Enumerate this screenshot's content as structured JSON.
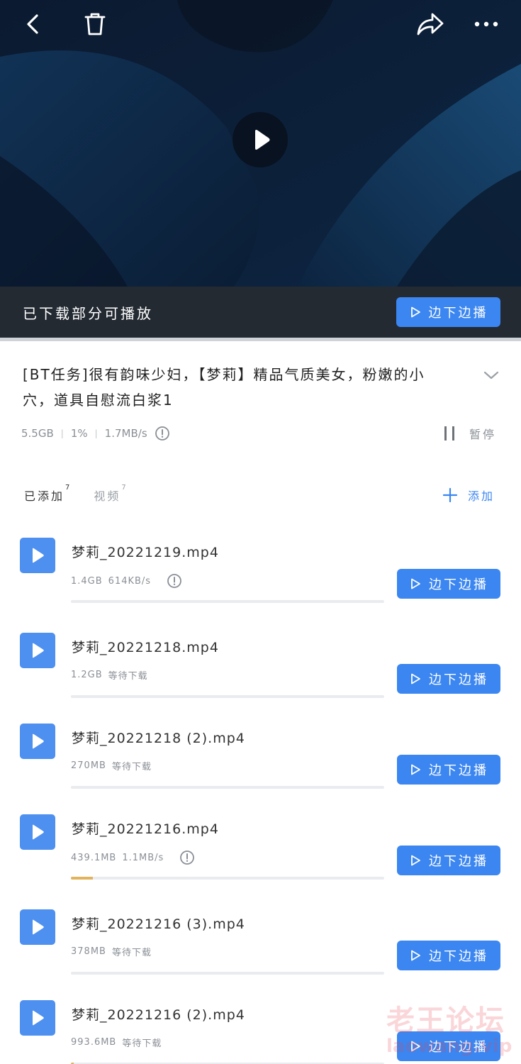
{
  "header": {
    "back_icon": "chevron-left-icon",
    "trash_icon": "trash-icon",
    "share_icon": "share-arrow-icon",
    "more_icon": "more-dots-icon",
    "play_icon": "play-icon"
  },
  "status": {
    "text": "已下载部分可播放",
    "play_button_label": "边下边播"
  },
  "task": {
    "title": "[BT任务]很有韵味少妇，【梦莉】精品气质美女，粉嫩的小穴，道具自慰流白浆1",
    "size": "5.5GB",
    "progress": "1%",
    "speed": "1.7MB/s",
    "pause_label": "暂停"
  },
  "tabs": [
    {
      "label": "已添加",
      "count": "7"
    },
    {
      "label": "视频",
      "count": "7"
    }
  ],
  "add_label": "添加",
  "files": [
    {
      "name": "梦莉_20221219.mp4",
      "size": "1.4GB",
      "status": "614KB/s",
      "show_info": true,
      "progress": 0,
      "button": "边下边播"
    },
    {
      "name": "梦莉_20221218.mp4",
      "size": "1.2GB",
      "status": "等待下载",
      "show_info": false,
      "progress": 0,
      "button": "边下边播"
    },
    {
      "name": "梦莉_20221218 (2).mp4",
      "size": "270MB",
      "status": "等待下载",
      "show_info": false,
      "progress": 0,
      "button": "边下边播"
    },
    {
      "name": "梦莉_20221216.mp4",
      "size": "439.1MB",
      "status": "1.1MB/s",
      "show_info": true,
      "progress": 0.07,
      "button": "边下边播"
    },
    {
      "name": "梦莉_20221216 (3).mp4",
      "size": "378MB",
      "status": "等待下载",
      "show_info": false,
      "progress": 0,
      "button": "边下边播"
    },
    {
      "name": "梦莉_20221216 (2).mp4",
      "size": "993.6MB",
      "status": "等待下载",
      "show_info": false,
      "progress": 0.01,
      "button": "边下边播"
    }
  ],
  "watermark": {
    "cn": "老王论坛",
    "en": "laowang.vip"
  },
  "colors": {
    "accent": "#3b86f0",
    "progress": "#e2b35d",
    "video_bg": "#0c1a2e"
  }
}
